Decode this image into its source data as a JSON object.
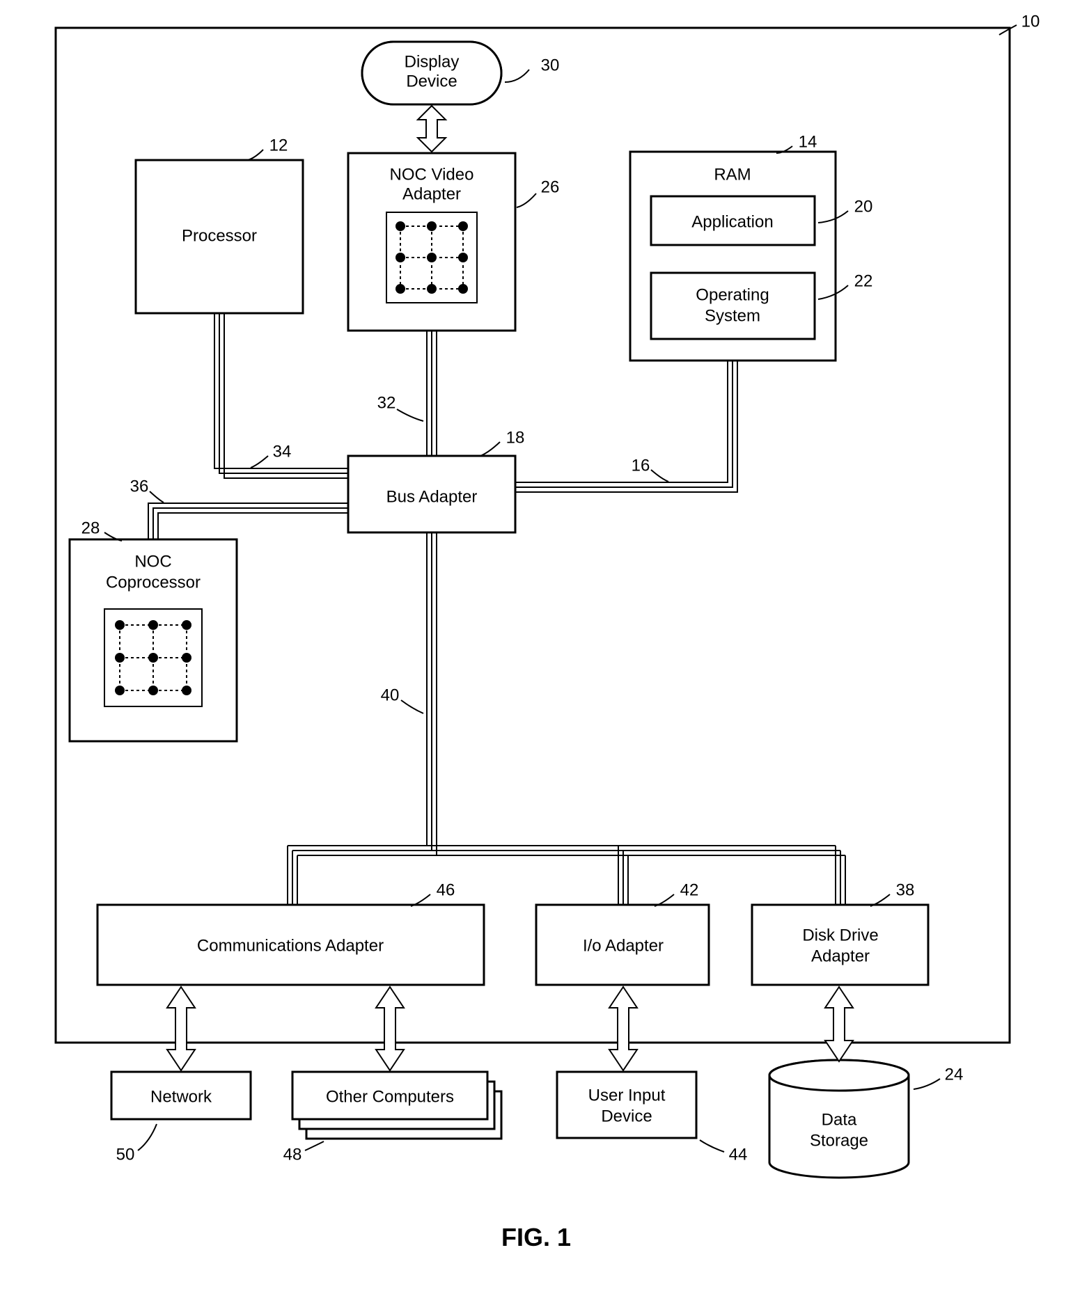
{
  "figure": "FIG. 1",
  "blocks": {
    "display": "Display Device",
    "processor": "Processor",
    "noc_video1": "NOC Video",
    "noc_video2": "Adapter",
    "ram": "RAM",
    "application": "Application",
    "os1": "Operating",
    "os2": "System",
    "bus_adapter": "Bus Adapter",
    "noc_cop1": "NOC",
    "noc_cop2": "Coprocessor",
    "comm": "Communications Adapter",
    "io": "I/o Adapter",
    "disk1": "Disk Drive",
    "disk2": "Adapter",
    "network": "Network",
    "other": "Other Computers",
    "user1": "User Input",
    "user2": "Device",
    "data1": "Data",
    "data2": "Storage"
  },
  "refs": {
    "r10": "10",
    "r12": "12",
    "r14": "14",
    "r16": "16",
    "r18": "18",
    "r20": "20",
    "r22": "22",
    "r24": "24",
    "r26": "26",
    "r28": "28",
    "r30": "30",
    "r32": "32",
    "r34": "34",
    "r36": "36",
    "r38": "38",
    "r40": "40",
    "r42": "42",
    "r44": "44",
    "r46": "46",
    "r48": "48",
    "r50": "50"
  }
}
